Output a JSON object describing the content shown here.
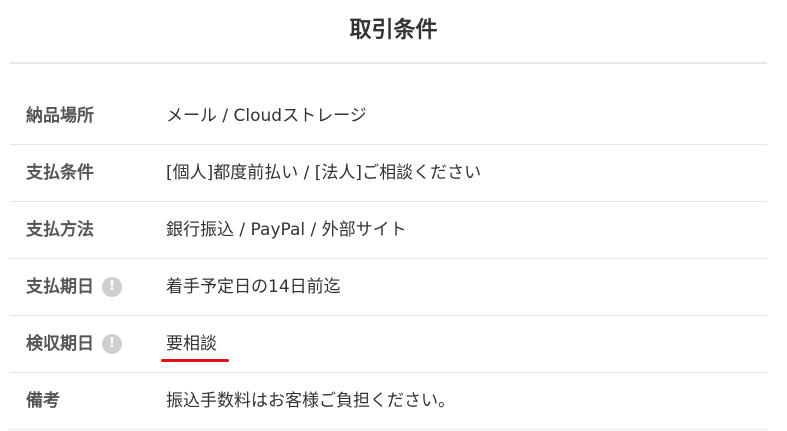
{
  "page": {
    "title": "取引条件"
  },
  "colors": {
    "divider": "#e6e6e6",
    "label": "#555555",
    "text": "#333333",
    "info_icon_bg": "#cfcfcf",
    "highlight_underline": "#e0141a"
  },
  "terms": [
    {
      "label": "納品場所",
      "value": "メール / Cloudストレージ",
      "has_info_icon": false,
      "icon": ""
    },
    {
      "label": "支払条件",
      "value": "[個人]都度前払い / [法人]ご相談ください",
      "has_info_icon": false,
      "icon": ""
    },
    {
      "label": "支払方法",
      "value": "銀行振込 / PayPal / 外部サイト",
      "has_info_icon": false,
      "icon": ""
    },
    {
      "label": "支払期日",
      "value": "着手予定日の14日前迄",
      "has_info_icon": true,
      "icon": "info-icon"
    },
    {
      "label": "検収期日",
      "value": "要相談",
      "has_info_icon": true,
      "icon": "info-icon",
      "underlined": true
    },
    {
      "label": "備考",
      "value": "振込手数料はお客様ご負担ください。",
      "has_info_icon": false,
      "icon": ""
    }
  ],
  "info_icon_glyph": "!"
}
